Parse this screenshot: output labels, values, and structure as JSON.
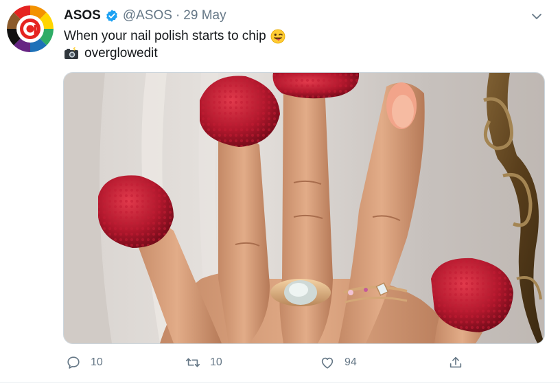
{
  "tweet": {
    "display_name": "ASOS",
    "handle": "@ASOS",
    "separator": "·",
    "date": "29 May",
    "text_line1": "When your nail polish starts to chip",
    "text_line2": "overglowedit",
    "icons": {
      "avatar": "asos-rainbow-logo",
      "verified": "verified-badge-icon",
      "caret": "chevron-down-icon",
      "emoji1": "winking-face-tongue-emoji",
      "emoji2": "camera-with-flash-emoji"
    }
  },
  "media": {
    "subject": "hand-with-raspberries-on-fingertips"
  },
  "actions": {
    "reply_count": "10",
    "retweet_count": "10",
    "like_count": "94"
  },
  "colors": {
    "verified_blue": "#1da1f2",
    "secondary_text": "#657786"
  }
}
